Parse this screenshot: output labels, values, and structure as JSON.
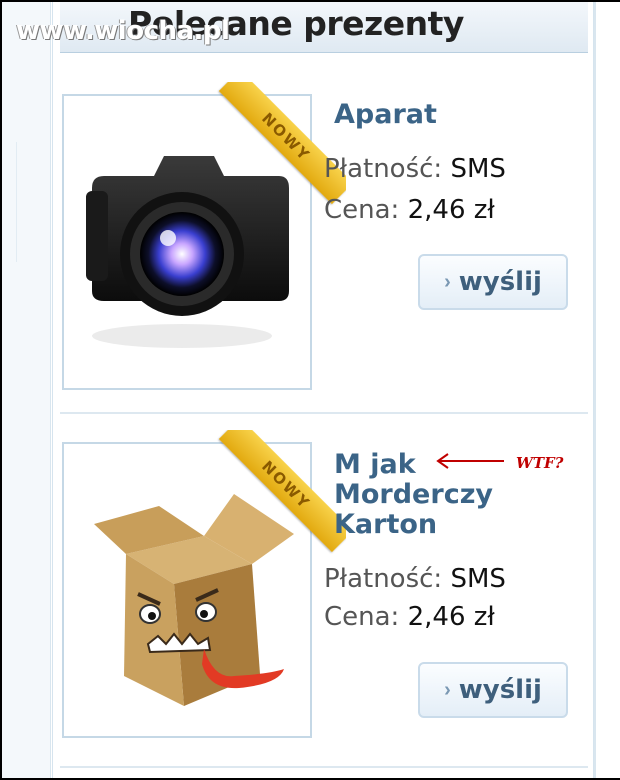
{
  "watermark": "www.wiocha.pl",
  "section": {
    "title": "Polecane prezenty"
  },
  "products": [
    {
      "name": "Aparat",
      "badge": "NOWY",
      "image_icon": "camera-icon",
      "payment_label": "Płatność:",
      "payment_value": "SMS",
      "price_label": "Cena:",
      "price_value": "2,46 zł",
      "button_label": "wyślij"
    },
    {
      "name": "M jak Morderczy Karton",
      "name_lines": [
        "M jak",
        "Morderczy",
        "Karton"
      ],
      "badge": "NOWY",
      "image_icon": "angry-box-icon",
      "payment_label": "Płatność:",
      "payment_value": "SMS",
      "price_label": "Cena:",
      "price_value": "2,46 zł",
      "button_label": "wyślij"
    }
  ],
  "annotation": {
    "text": "WTF?",
    "color": "#c00000"
  },
  "colors": {
    "accent": "#3b6487",
    "badge": "#f0bd24",
    "border": "#c5d8e6"
  }
}
